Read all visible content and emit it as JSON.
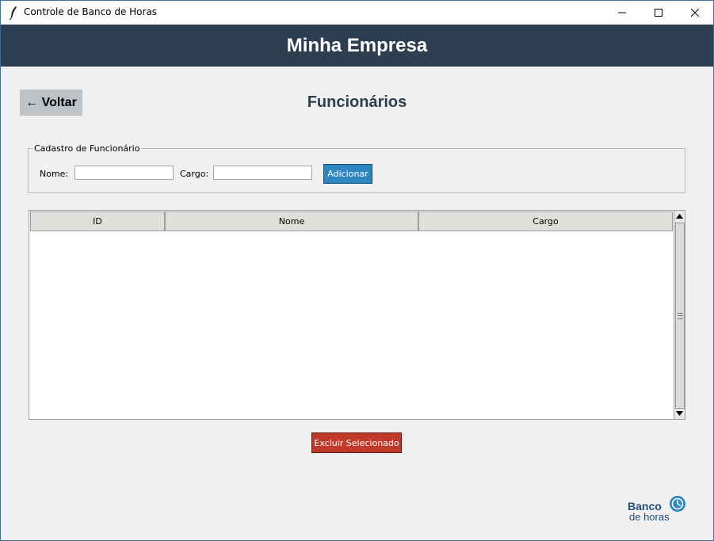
{
  "window": {
    "title": "Controle de Banco de Horas"
  },
  "header": {
    "company": "Minha Empresa"
  },
  "nav": {
    "back_label": "← Voltar"
  },
  "page": {
    "title": "Funcionários"
  },
  "form": {
    "legend": "Cadastro de Funcionário",
    "nome_label": "Nome:",
    "nome_value": "",
    "cargo_label": "Cargo:",
    "cargo_value": "",
    "add_label": "Adicionar"
  },
  "table": {
    "columns": [
      "ID",
      "Nome",
      "Cargo"
    ],
    "rows": []
  },
  "actions": {
    "delete_label": "Excluir Selecionado"
  },
  "logo": {
    "line1": "Banco",
    "line2": "de horas"
  },
  "colors": {
    "header_bg": "#2c3e50",
    "add_button": "#2e86c1",
    "delete_button": "#c0392b",
    "back_button": "#bdc3c7",
    "logo": "#2e86c1"
  }
}
